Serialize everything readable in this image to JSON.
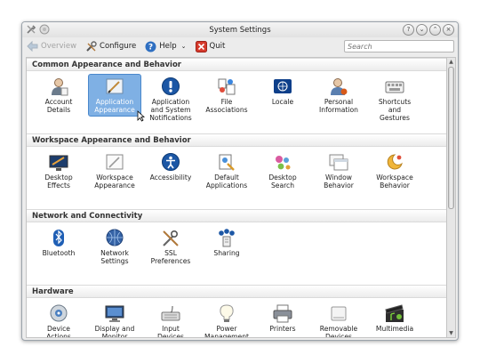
{
  "window": {
    "title": "System Settings"
  },
  "toolbar": {
    "overview_label": "Overview",
    "configure_label": "Configure",
    "help_label": "Help",
    "quit_label": "Quit",
    "search_placeholder": "Search"
  },
  "sections": [
    {
      "title": "Common Appearance and Behavior",
      "items": [
        {
          "label": "Account\nDetails",
          "icon": "account-icon"
        },
        {
          "label": "Application\nAppearance",
          "icon": "appearance-icon",
          "selected": true
        },
        {
          "label": "Application\nand System\nNotifications",
          "icon": "notifications-icon"
        },
        {
          "label": "File\nAssociations",
          "icon": "file-associations-icon"
        },
        {
          "label": "Locale",
          "icon": "locale-icon"
        },
        {
          "label": "Personal\nInformation",
          "icon": "personal-info-icon"
        },
        {
          "label": "Shortcuts\nand\nGestures",
          "icon": "shortcuts-icon"
        }
      ]
    },
    {
      "title": "Workspace Appearance and Behavior",
      "items": [
        {
          "label": "Desktop\nEffects",
          "icon": "desktop-effects-icon"
        },
        {
          "label": "Workspace\nAppearance",
          "icon": "workspace-appearance-icon"
        },
        {
          "label": "Accessibility",
          "icon": "accessibility-icon"
        },
        {
          "label": "Default\nApplications",
          "icon": "default-apps-icon"
        },
        {
          "label": "Desktop\nSearch",
          "icon": "desktop-search-icon"
        },
        {
          "label": "Window\nBehavior",
          "icon": "window-behavior-icon"
        },
        {
          "label": "Workspace\nBehavior",
          "icon": "workspace-behavior-icon"
        }
      ]
    },
    {
      "title": "Network and Connectivity",
      "items": [
        {
          "label": "Bluetooth",
          "icon": "bluetooth-icon"
        },
        {
          "label": "Network\nSettings",
          "icon": "network-icon"
        },
        {
          "label": "SSL\nPreferences",
          "icon": "ssl-icon"
        },
        {
          "label": "Sharing",
          "icon": "sharing-icon"
        }
      ]
    },
    {
      "title": "Hardware",
      "items": [
        {
          "label": "Device\nActions",
          "icon": "device-actions-icon"
        },
        {
          "label": "Display and\nMonitor",
          "icon": "display-icon"
        },
        {
          "label": "Input\nDevices",
          "icon": "input-devices-icon"
        },
        {
          "label": "Power\nManagement",
          "icon": "power-icon"
        },
        {
          "label": "Printers",
          "icon": "printer-icon"
        },
        {
          "label": "Removable\nDevices",
          "icon": "removable-icon"
        },
        {
          "label": "Multimedia",
          "icon": "multimedia-icon"
        }
      ]
    }
  ]
}
